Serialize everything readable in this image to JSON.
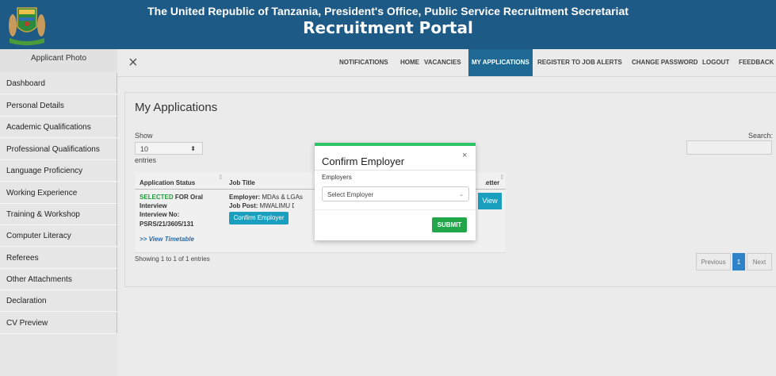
{
  "header": {
    "line1": "The United Republic of Tanzania, President's Office, Public Service Recruitment Secretariat",
    "line2": "Recruitment Portal"
  },
  "sidebar": {
    "photo_label": "Applicant Photo",
    "items": [
      {
        "label": "Dashboard"
      },
      {
        "label": "Personal Details"
      },
      {
        "label": "Academic Qualifications"
      },
      {
        "label": "Professional Qualifications"
      },
      {
        "label": "Language Proficiency"
      },
      {
        "label": "Working Experience"
      },
      {
        "label": "Training & Workshop"
      },
      {
        "label": "Computer Literacy"
      },
      {
        "label": "Referees"
      },
      {
        "label": "Other Attachments"
      },
      {
        "label": "Declaration"
      },
      {
        "label": "CV Preview"
      }
    ]
  },
  "nav": {
    "close_icon": "×",
    "items": [
      {
        "label": "NOTIFICATIONS"
      },
      {
        "label": "HOME"
      },
      {
        "label": "VACANCIES"
      },
      {
        "label": "MY APPLICATIONS",
        "active": true
      },
      {
        "label": "REGISTER TO JOB ALERTS"
      },
      {
        "label": "CHANGE PASSWORD"
      },
      {
        "label": "LOGOUT"
      },
      {
        "label": "FEEDBACK"
      }
    ]
  },
  "main": {
    "title": "My Applications",
    "show_label": "Show",
    "entries_value": "10",
    "entries_label": "entries",
    "search_label": "Search:",
    "search_value": "",
    "table": {
      "headers": [
        "Application Status",
        "Job Title",
        "Letter"
      ],
      "row": {
        "status_green": "SELECTED",
        "status_rest": " FOR Oral",
        "status_line2": "Interview",
        "interview_no_label": "Interview No:",
        "interview_no": "PSRS/21/3605/131",
        "employer_label": "Employer:",
        "employer_value": " MDAs & LGAs",
        "job_post_label": "Job Post:",
        "job_post_value": " MWALIMU DARAJ",
        "confirm_button": "Confirm Employer",
        "timetable_link": ">> View Timetable",
        "view_button": "View"
      }
    },
    "showing_text": "Showing 1 to 1 of 1 entries",
    "pagination": {
      "previous": "Previous",
      "current": "1",
      "next": "Next"
    }
  },
  "modal": {
    "title": "Confirm Employer",
    "close": "×",
    "employers_label": "Employers",
    "select_placeholder": "Select Employer",
    "submit": "SUBMIT"
  },
  "colors": {
    "header_bg": "#1e5a86",
    "active_nav": "#1f6a94",
    "status_green": "#1e9c3c",
    "button_teal": "#1a9fbf",
    "submit_green": "#22a64a",
    "modal_top": "#2ec468"
  },
  "icons": {
    "emblem": "coat-of-arms-icon",
    "close": "close-icon",
    "dropdown": "chevron-down-icon"
  }
}
